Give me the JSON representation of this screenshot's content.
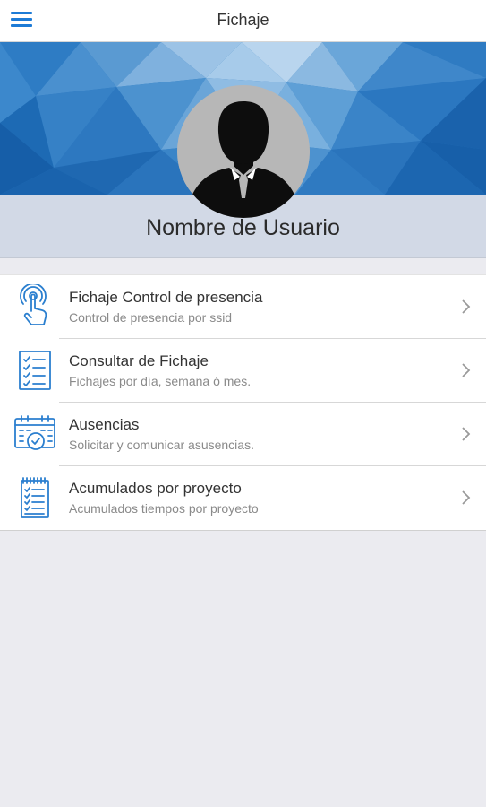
{
  "header": {
    "title": "Fichaje",
    "menu_icon": "hamburger-menu-icon"
  },
  "colors": {
    "accent": "#1d7bd6",
    "banner_blue": "#1f6cb6",
    "name_band": "#d2d9e6",
    "background": "#ebebf0"
  },
  "profile": {
    "avatar_icon": "user-silhouette-icon",
    "user_name": "Nombre de Usuario"
  },
  "menu": {
    "items": [
      {
        "title": "Fichaje Control de presencia",
        "subtitle": "Control de presencia por ssid",
        "icon": "touch-hand-icon"
      },
      {
        "title": "Consultar de Fichaje",
        "subtitle": "Fichajes por día, semana ó mes.",
        "icon": "checklist-icon"
      },
      {
        "title": "Ausencias",
        "subtitle": "Solicitar y comunicar asusencias.",
        "icon": "calendar-check-icon"
      },
      {
        "title": "Acumulados por proyecto",
        "subtitle": "Acumulados tiempos por proyecto",
        "icon": "clipboard-list-icon"
      }
    ]
  }
}
